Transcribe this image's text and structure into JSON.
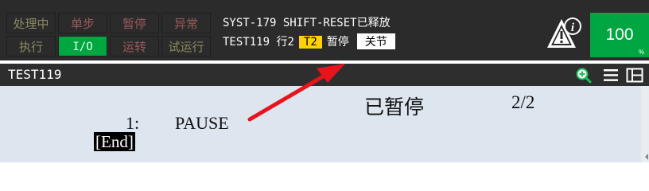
{
  "status_panel": {
    "processing": "处理中",
    "step": "单步",
    "hold": "暂停",
    "fault": "异常",
    "run": "执行",
    "io": "I/O",
    "running": "运转",
    "test_run": "试运行"
  },
  "message": {
    "line1": "SYST-179 SHIFT-RESET已释放",
    "program": "TEST119",
    "row": "行2",
    "mode_badge": "T2",
    "state": "暂停",
    "coord_badge": "关节"
  },
  "speed_override": {
    "value": "100",
    "unit": "%"
  },
  "title_bar": {
    "program_name": "TEST119"
  },
  "editor": {
    "status": "已暂停",
    "line_counter": "2/2",
    "lines": [
      {
        "number": "1:",
        "command": "PAUSE"
      }
    ],
    "end_marker": "[End]"
  },
  "colors": {
    "status_active": "#00a63f",
    "mode_badge": "#ffd200",
    "annotation_arrow": "#e8141b",
    "editor_background": "#dde5ef"
  },
  "icons": {
    "alarm": "alarm-info-icon",
    "zoom": "zoom-in-icon",
    "menu": "menu-icon",
    "layout": "split-layout-icon"
  }
}
